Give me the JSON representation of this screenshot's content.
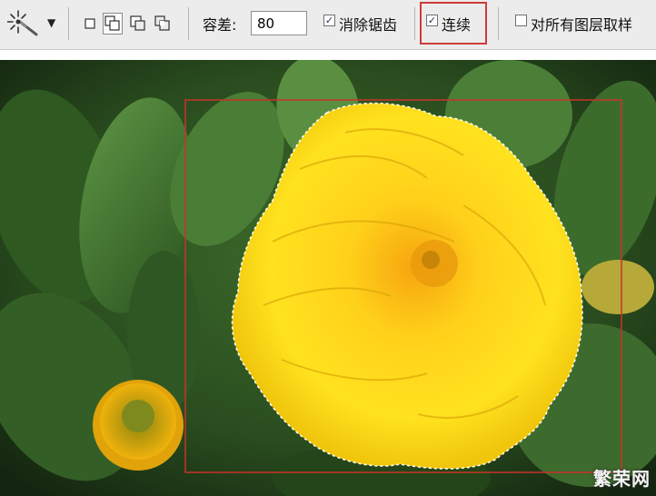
{
  "toolbar": {
    "tool_icon": "magic-wand-icon",
    "preset_arrow_icon": "chevron-down-icon",
    "selection_modes": [
      {
        "name": "new-selection-icon",
        "active": false
      },
      {
        "name": "add-to-selection-icon",
        "active": true
      },
      {
        "name": "subtract-from-selection-icon",
        "active": false
      },
      {
        "name": "intersect-selection-icon",
        "active": false
      }
    ],
    "tolerance_label": "容差:",
    "tolerance_value": "80",
    "antialias": {
      "label": "消除锯齿",
      "checked": true
    },
    "contiguous": {
      "label": "连续",
      "checked": true
    },
    "sample_all_layers": {
      "label": "对所有图层取样",
      "checked": false
    },
    "highlight_color": "#cf3a3a"
  },
  "canvas": {
    "image_subject": "yellow-marigold-photo",
    "marquee_color": "#c8332b"
  },
  "watermark": {
    "text": "繁荣网"
  },
  "colors": {
    "toolbar_bg": "#ececec",
    "checkmark": "#1d2e5e"
  }
}
